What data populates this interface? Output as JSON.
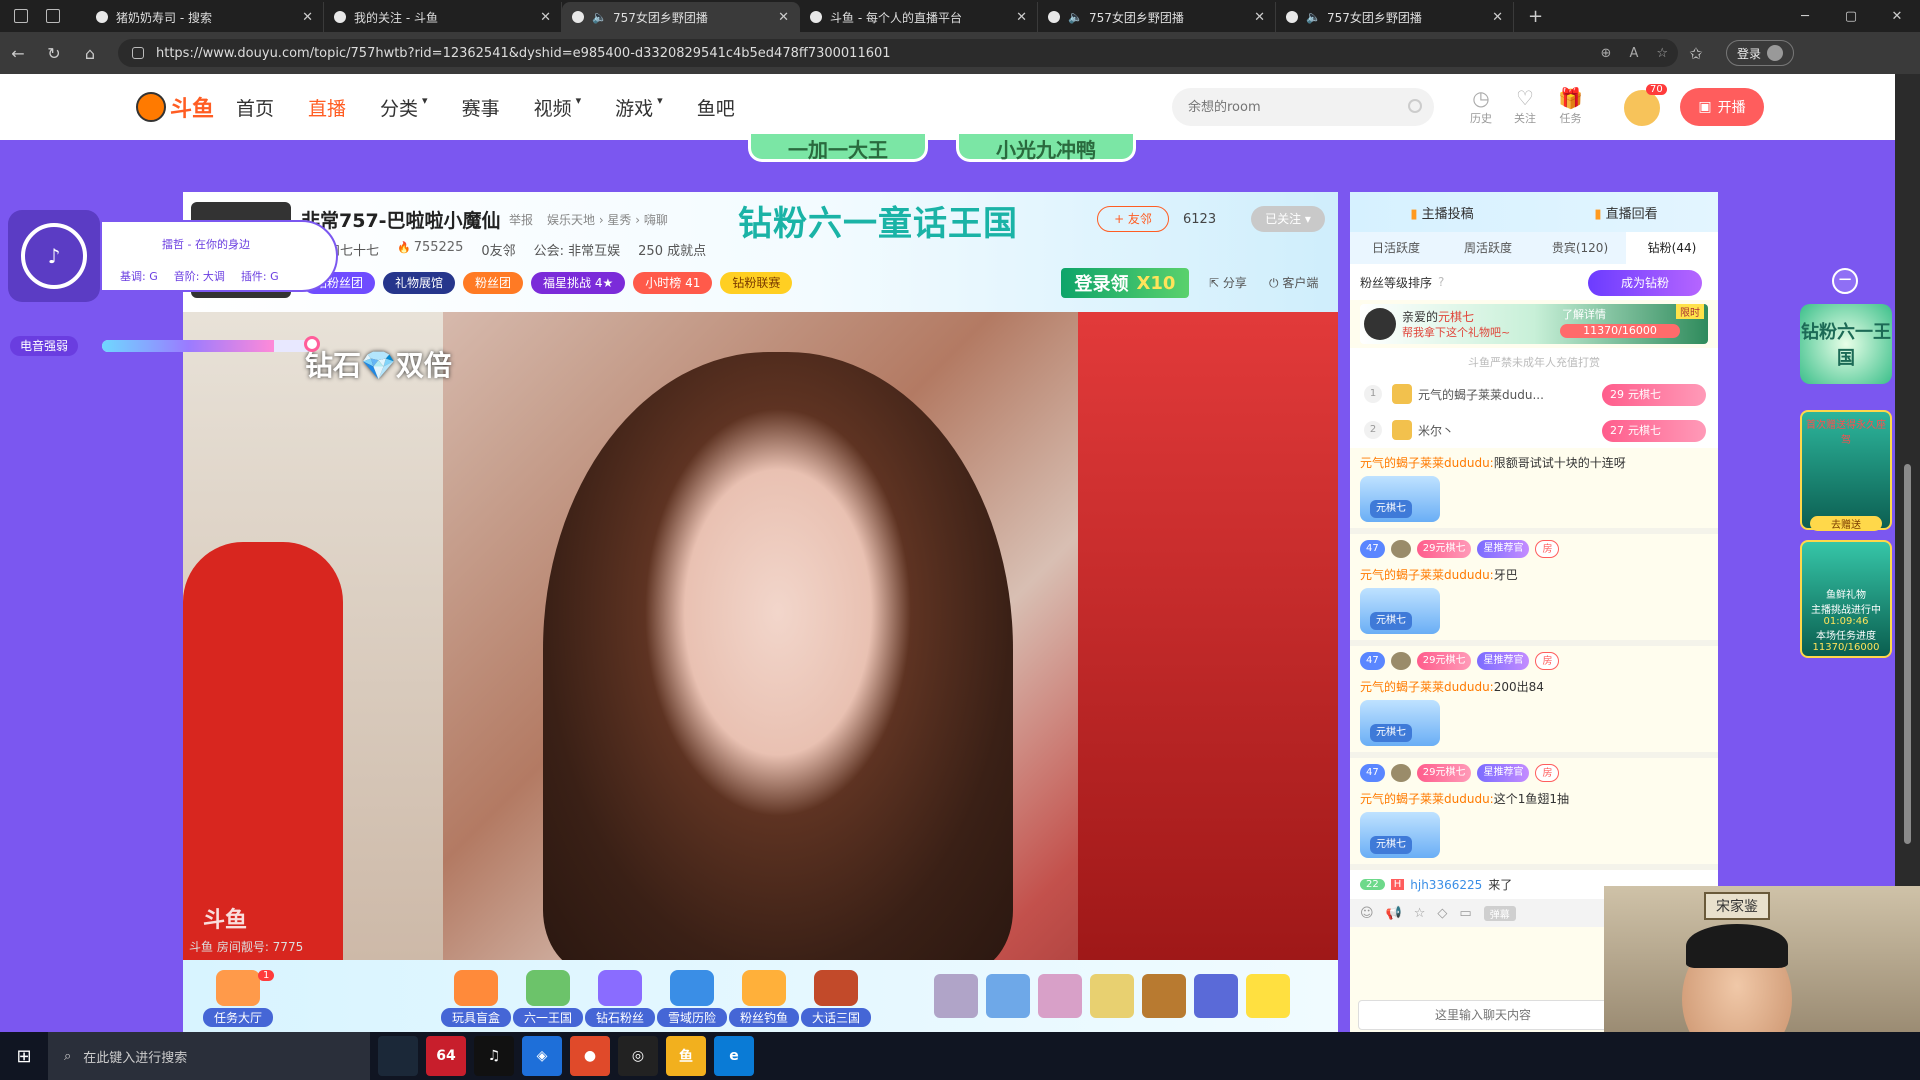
{
  "browser": {
    "tabs": [
      {
        "title": "猪奶奶寿司 - 搜索",
        "audio": false
      },
      {
        "title": "我的关注 - 斗鱼",
        "audio": false
      },
      {
        "title": "757女团乡野团播",
        "audio": true,
        "active": true
      },
      {
        "title": "斗鱼 - 每个人的直播平台",
        "audio": false
      },
      {
        "title": "757女团乡野团播",
        "audio": true
      },
      {
        "title": "757女团乡野团播",
        "audio": true
      }
    ],
    "url": "https://www.douyu.com/topic/757hwtb?rid=12362541&dyshid=e985400-d3320829541c4b5ed478ff7300011601",
    "login_label": "登录"
  },
  "site": {
    "logo_text": "斗鱼",
    "nav": [
      {
        "label": "首页",
        "active": false
      },
      {
        "label": "直播",
        "active": true
      },
      {
        "label": "分类",
        "dropdown": true
      },
      {
        "label": "赛事"
      },
      {
        "label": "视频",
        "dropdown": true
      },
      {
        "label": "游戏",
        "dropdown": true
      },
      {
        "label": "鱼吧"
      }
    ],
    "search_placeholder": "余想的room",
    "header_icons": [
      {
        "label": "历史",
        "icon": "clock-icon",
        "glyph": "◷"
      },
      {
        "label": "关注",
        "icon": "heart-icon",
        "glyph": "♡"
      },
      {
        "label": "任务",
        "icon": "gift-icon",
        "glyph": "🎁"
      }
    ],
    "user_level": "70",
    "broadcast_label": "开播",
    "top_banners": [
      "一加一大王",
      "小光九冲鸭"
    ]
  },
  "room": {
    "title": "非常757-巴啦啦小魔仙",
    "report": "举报",
    "categories": "娱乐天地 › 星秀 › 嗨聊",
    "event_title": "钻粉六一童话王国",
    "follow_label": "+ 友邻",
    "follow_count": "6123",
    "followed_label": "已关注",
    "anchor_name": "七百和七十七",
    "hot": "755225",
    "neighbors": "0友邻",
    "guild": "公会: 非常互娱",
    "achievements": "250 成就点",
    "tags": [
      "钻粉丝团",
      "礼物展馆",
      "粉丝团",
      "福星挑战 4★",
      "小时榜 41",
      "钻粉联赛"
    ],
    "login_reward": "登录领",
    "login_reward_mult": "X10",
    "share": "分享",
    "client": "客户端"
  },
  "video": {
    "overlay_text": "钻石💎双倍",
    "watermark": "斗鱼",
    "room_number": "斗鱼 房间靓号: 7775"
  },
  "music": {
    "song": "擂哲 - 在你的身边",
    "params": [
      "基调: G",
      "音阶: 大调",
      "插件: G"
    ],
    "effect_label": "电音强弱",
    "effect_level": 0.82
  },
  "toolbar": {
    "tools": [
      {
        "label": "任务大厅",
        "badge": "1"
      },
      {
        "label": "玩具盲盒"
      },
      {
        "label": "六一王国"
      },
      {
        "label": "钻石粉丝"
      },
      {
        "label": "雪域历险"
      },
      {
        "label": "粉丝钓鱼"
      },
      {
        "label": "大话三国"
      }
    ]
  },
  "chat": {
    "header": [
      "主播投稿",
      "直播回看"
    ],
    "rank_tabs": [
      "日活跃度",
      "周活跃度",
      "贵宾(120)",
      "钻粉(44)"
    ],
    "fan_rank_label": "粉丝等级排序",
    "become_diamond": "成为钻粉",
    "promo": {
      "line1_prefix": "亲爱的",
      "line1_name": "元棋七",
      "line2": "帮我拿下这个礼物吧~",
      "learn": "了解详情",
      "limit": "限时",
      "progress": "11370/16000"
    },
    "notice": "斗鱼严禁未成年人充值打赏",
    "rank_list": [
      {
        "no": "1",
        "name": "元气的蝎子莱莱dudu...",
        "level": "29",
        "badge": "元棋七"
      },
      {
        "no": "2",
        "name": "米尔丶",
        "level": "27",
        "badge": "元棋七"
      }
    ],
    "messages": [
      {
        "user": "元气的蝎子莱莱dududu:",
        "text": "限额哥试试十块的十连呀",
        "sticker": "元棋七",
        "badges": false
      },
      {
        "user": "元气的蝎子莱莱dududu:",
        "text": "牙巴",
        "sticker": "元棋七",
        "badges": true
      },
      {
        "user": "元气的蝎子莱莱dududu:",
        "text": "200出84",
        "sticker": "元棋七",
        "badges": true
      },
      {
        "user": "元气的蝎子莱莱dududu:",
        "text": "这个1鱼翅1抽",
        "sticker": "元棋七",
        "badges": true
      }
    ],
    "badges": {
      "level": "47",
      "fans_level": "29",
      "fans": "元棋七",
      "star": "星推荐官",
      "room": "房"
    },
    "enter": {
      "level": "22",
      "user": "hjh3366225",
      "text": "来了"
    },
    "tools_tag": "弹幕",
    "input_placeholder": "这里输入聊天内容"
  },
  "event_side": {
    "ev1": "钻粉六一王国",
    "ev2_top": "首次赠送得永久座驾",
    "ev2_btn": "去赠送",
    "ev3_l1": "鱼鲜礼物",
    "ev3_l2": "主播挑战进行中",
    "ev3_time": "01:09:46",
    "ev3_prog_label": "本场任务进度",
    "ev3_prog": "11370/16000"
  },
  "webcam": {
    "sign": "宋家鉴"
  },
  "taskbar": {
    "search": "在此键入进行搜索",
    "apps": [
      {
        "name": "steam-icon",
        "color": "#1b2838",
        "label": ""
      },
      {
        "name": "app-64-icon",
        "color": "#c81e2c",
        "label": "64"
      },
      {
        "name": "music-app-icon",
        "color": "#111",
        "label": "♫"
      },
      {
        "name": "folder-app-icon",
        "color": "#1e6fd9",
        "label": "◈"
      },
      {
        "name": "chrome-icon",
        "color": "#e04a2a",
        "label": "●"
      },
      {
        "name": "obs-icon",
        "color": "#222",
        "label": "◎"
      },
      {
        "name": "douyu-app-icon",
        "color": "#f2b01e",
        "label": "鱼"
      },
      {
        "name": "edge-icon",
        "color": "#0a7bd6",
        "label": "e"
      }
    ]
  }
}
